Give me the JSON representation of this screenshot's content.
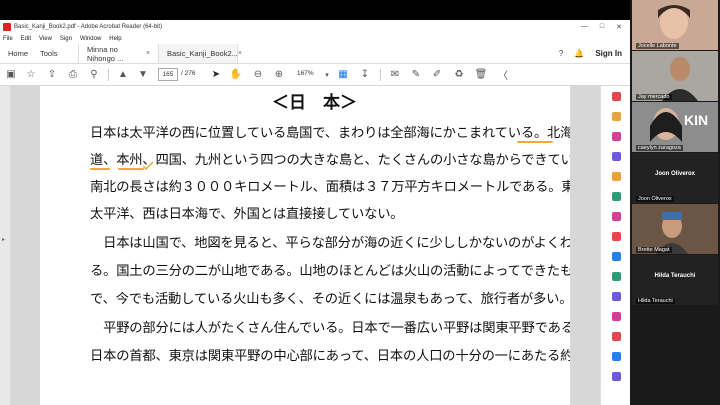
{
  "window": {
    "title": "Basic_Kanji_Book2.pdf - Adobe Acrobat Reader (64-bit)",
    "menu": [
      "File",
      "Edit",
      "View",
      "Sign",
      "Window",
      "Help"
    ]
  },
  "tabs": {
    "home": "Home",
    "tools": "Tools",
    "docs": [
      "Minna no Nihongo ...",
      "Basic_Kanji_Book2..."
    ],
    "sign_in": "Sign In"
  },
  "toolbar": {
    "page_current": "165",
    "page_total": "/ 276",
    "zoom": "167%"
  },
  "document": {
    "title": "＜日　本＞",
    "lines": [
      "日本は太平洋の西に位置している島国で、まわりは全部海にかこまれている。北海",
      "道、本州、四国、九州という四つの大きな島と、たくさんの小さな島からできている。",
      "南北の長さは約３０００キロメートル、面積は３７万平方キロメートルである。東は",
      "太平洋、西は日本海で、外国とは直接接していない。",
      "　日本は山国で、地図を見ると、平らな部分が海の近くに少ししかないのがよくわか",
      "る。国土の三分の二が山地である。山地のほとんどは火山の活動によってできたもの",
      "で、今でも活動している火山も多く、その近くには温泉もあって、旅行者が多い。",
      "　平野の部分には人がたくさん住んでいる。日本で一番広い平野は関東平野である。",
      "日本の首都、東京は関東平野の中心部にあって、日本の人口の十分の一にあたる約千"
    ]
  },
  "participants": [
    {
      "name": "Jocelle Labonte"
    },
    {
      "name": "Jay mercado"
    },
    {
      "name": "caeylyn zaragoza",
      "overlay": "KIN"
    },
    {
      "name": "Joon Oliverox",
      "center": "Joon Oliverox"
    },
    {
      "name": "Joon Oliverox"
    },
    {
      "name": "Brette Magat"
    },
    {
      "name": "Hilda Terauchi",
      "center": "Hilda Terauchi"
    },
    {
      "name": "Hilda Terauchi"
    }
  ],
  "colors": {
    "ink": "#f2a83b",
    "pdf_red": "#d9261c",
    "zoom_bg": "#1a1a1a"
  }
}
